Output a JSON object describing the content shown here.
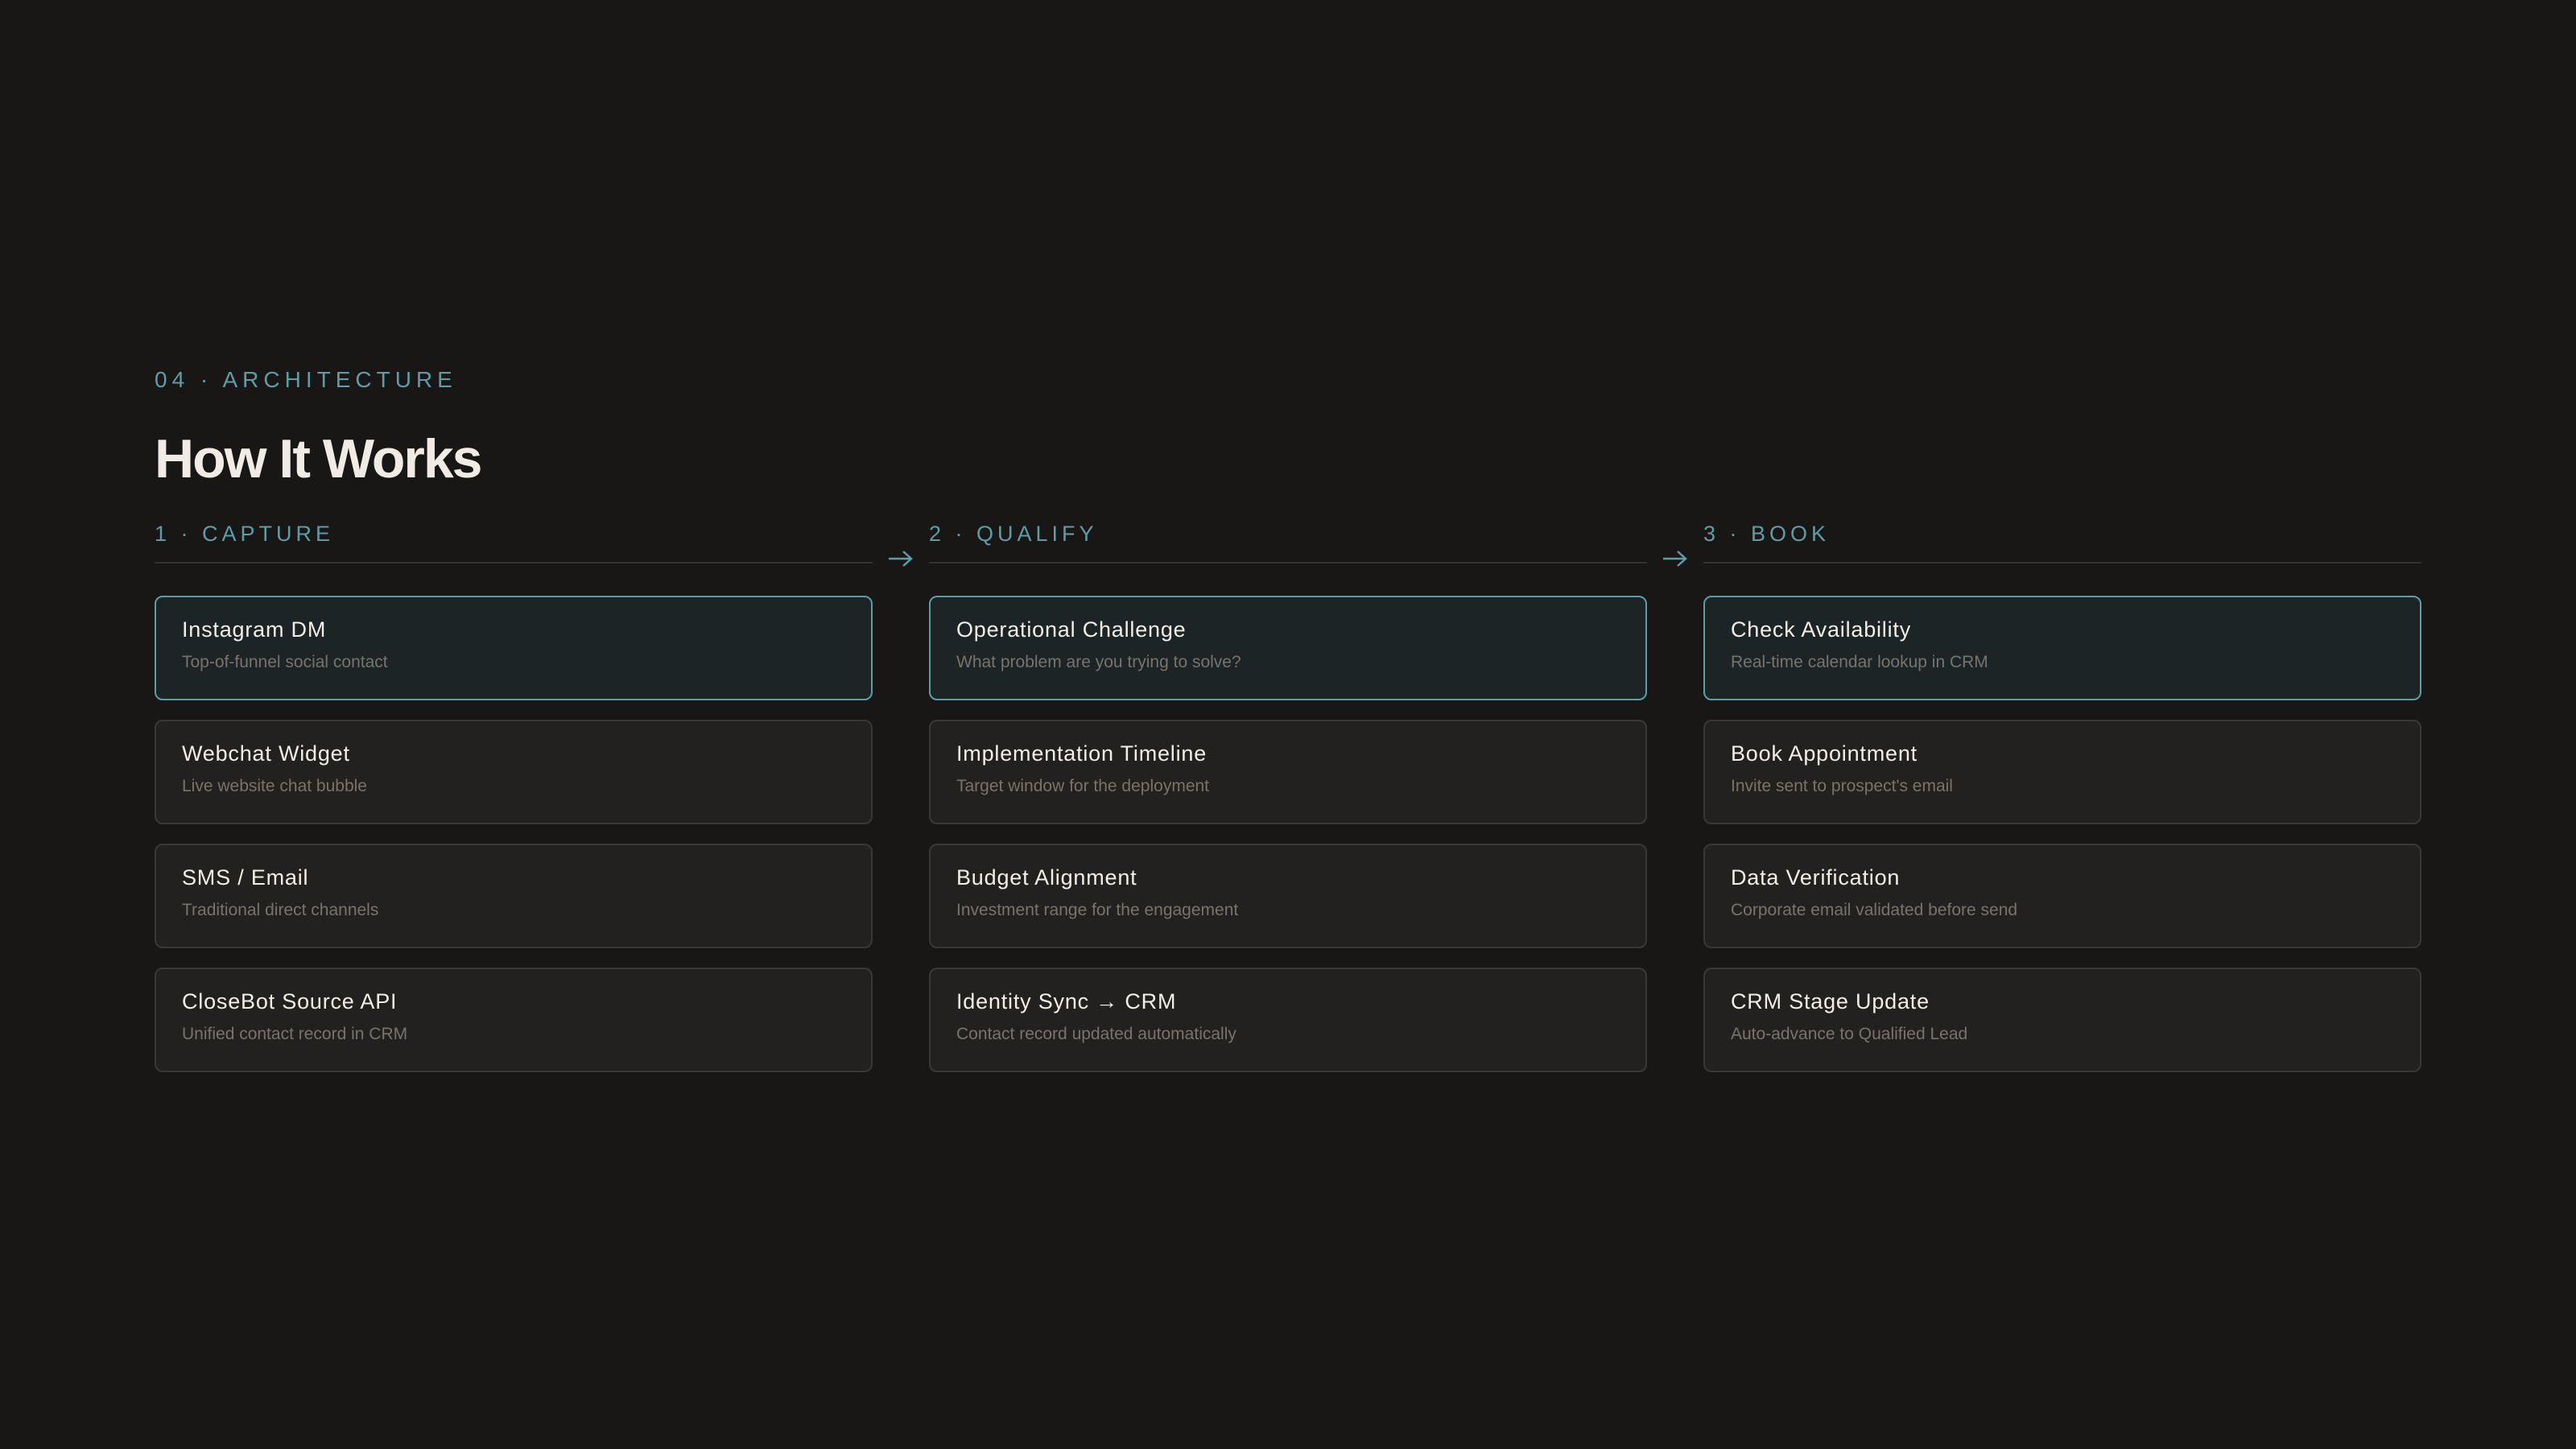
{
  "header": {
    "eyebrow": "04 · ARCHITECTURE",
    "title": "How It Works"
  },
  "colors": {
    "background": "#181716",
    "accent": "#5c9ea8",
    "card": "#232120",
    "card_active": "#1d2425"
  },
  "arrow_icon": "arrow-right-icon",
  "columns": [
    {
      "label": "1 · CAPTURE",
      "cards": [
        {
          "title": "Instagram DM",
          "subtitle": "Top-of-funnel social contact",
          "highlighted": true
        },
        {
          "title": "Webchat Widget",
          "subtitle": "Live website chat bubble",
          "highlighted": false
        },
        {
          "title": "SMS / Email",
          "subtitle": "Traditional direct channels",
          "highlighted": false
        },
        {
          "title": "CloseBot Source API",
          "subtitle": "Unified contact record in CRM",
          "highlighted": false
        }
      ]
    },
    {
      "label": "2 · QUALIFY",
      "cards": [
        {
          "title": "Operational Challenge",
          "subtitle": "What problem are you trying to solve?",
          "highlighted": true
        },
        {
          "title": "Implementation Timeline",
          "subtitle": "Target window for the deployment",
          "highlighted": false
        },
        {
          "title": "Budget Alignment",
          "subtitle": "Investment range for the engagement",
          "highlighted": false
        },
        {
          "title": "Identity Sync → CRM",
          "subtitle": "Contact record updated automatically",
          "highlighted": false
        }
      ]
    },
    {
      "label": "3 · BOOK",
      "cards": [
        {
          "title": "Check Availability",
          "subtitle": "Real-time calendar lookup in CRM",
          "highlighted": true
        },
        {
          "title": "Book Appointment",
          "subtitle": "Invite sent to prospect's email",
          "highlighted": false
        },
        {
          "title": "Data Verification",
          "subtitle": "Corporate email validated before send",
          "highlighted": false
        },
        {
          "title": "CRM Stage Update",
          "subtitle": "Auto-advance to Qualified Lead",
          "highlighted": false
        }
      ]
    }
  ]
}
